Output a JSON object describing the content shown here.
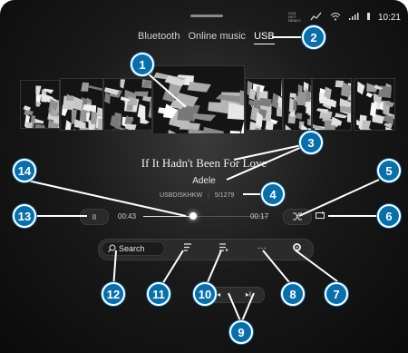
{
  "status_bar": {
    "sos_label": "SOS NOT READY",
    "time": "10:21",
    "icons": [
      "signal-icon",
      "wifi-icon",
      "cellular-icon",
      "battery-icon"
    ]
  },
  "tabs": [
    {
      "label": "Bluetooth",
      "active": false
    },
    {
      "label": "Online music",
      "active": false
    },
    {
      "label": "USB",
      "active": true
    }
  ],
  "track": {
    "title": "If It Hadn't Been For Love",
    "artist": "Adele",
    "source": "USBDISKHKW",
    "position": "5/1279",
    "elapsed": "00:43",
    "remaining": "00:17",
    "progress": 0.4
  },
  "controls": {
    "pause": "II",
    "shuffle": "shuffle-icon",
    "repeat": "repeat-icon",
    "search_label": "Search",
    "more": "···",
    "prev": "I◂",
    "next": "▸I"
  },
  "callouts": [
    "1",
    "2",
    "3",
    "4",
    "5",
    "6",
    "7",
    "8",
    "9",
    "10",
    "11",
    "12",
    "13",
    "14"
  ],
  "colors": {
    "callout": "#0a6fa8",
    "background": "#1a1a1a"
  }
}
